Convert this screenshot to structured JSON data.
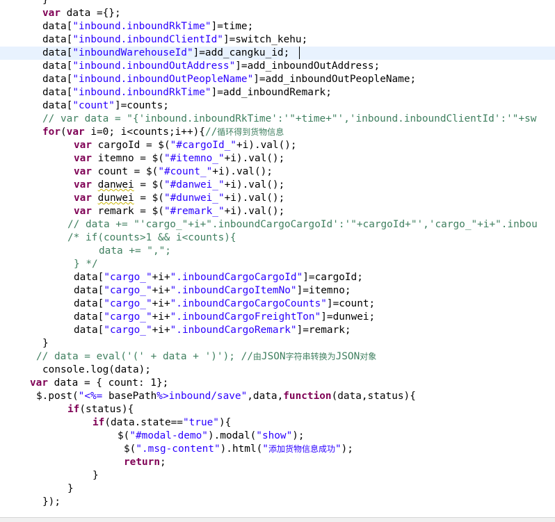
{
  "editor": {
    "current_line": 4,
    "lines": [
      {
        "indent": 61,
        "tokens": [
          {
            "t": "}",
            "c": "tx"
          }
        ]
      },
      {
        "indent": 61,
        "tokens": [
          {
            "t": "var",
            "c": "kw"
          },
          {
            "t": " data ={};",
            "c": "tx"
          }
        ]
      },
      {
        "indent": 61,
        "tokens": [
          {
            "t": "data[",
            "c": "tx"
          },
          {
            "t": "\"inbound.inboundRkTime\"",
            "c": "str"
          },
          {
            "t": "]=time;",
            "c": "tx"
          }
        ]
      },
      {
        "indent": 61,
        "tokens": [
          {
            "t": "data[",
            "c": "tx"
          },
          {
            "t": "\"inbound.inboundClientId\"",
            "c": "str"
          },
          {
            "t": "]=switch_kehu;",
            "c": "tx"
          }
        ]
      },
      {
        "indent": 61,
        "tokens": [
          {
            "t": "data[",
            "c": "tx"
          },
          {
            "t": "\"inboundWarehouseId\"",
            "c": "str"
          },
          {
            "t": "]=add_cangku_id;",
            "c": "tx"
          }
        ]
      },
      {
        "indent": 61,
        "tokens": [
          {
            "t": "data[",
            "c": "tx"
          },
          {
            "t": "\"inbound.inboundOutAddress\"",
            "c": "str"
          },
          {
            "t": "]=add_inboundOutAddress;",
            "c": "tx"
          }
        ]
      },
      {
        "indent": 61,
        "tokens": [
          {
            "t": "data[",
            "c": "tx"
          },
          {
            "t": "\"inbound.inboundOutPeopleName\"",
            "c": "str"
          },
          {
            "t": "]=add_inboundOutPeopleName;",
            "c": "tx"
          }
        ]
      },
      {
        "indent": 61,
        "tokens": [
          {
            "t": "data[",
            "c": "tx"
          },
          {
            "t": "\"inbound.inboundRkTime\"",
            "c": "str"
          },
          {
            "t": "]=add_inboundRemark;",
            "c": "tx"
          }
        ]
      },
      {
        "indent": 61,
        "tokens": [
          {
            "t": "data[",
            "c": "tx"
          },
          {
            "t": "\"count\"",
            "c": "str"
          },
          {
            "t": "]=counts;",
            "c": "tx"
          }
        ]
      },
      {
        "indent": 61,
        "tokens": [
          {
            "t": "// var data = \"{'inbound.inboundRkTime':'\"+time+\"','inbound.inboundClientId':'\"+sw",
            "c": "cm"
          }
        ]
      },
      {
        "indent": 61,
        "tokens": [
          {
            "t": "for",
            "c": "kw"
          },
          {
            "t": "(",
            "c": "tx"
          },
          {
            "t": "var",
            "c": "kw"
          },
          {
            "t": " i=0; i<counts;i++){",
            "c": "tx"
          },
          {
            "t": "//",
            "c": "cm"
          },
          {
            "t": "循环得到货物信息",
            "c": "cm",
            "cjk": true
          }
        ]
      },
      {
        "indent": 106,
        "tokens": [
          {
            "t": "var",
            "c": "kw"
          },
          {
            "t": " cargoId = $(",
            "c": "tx"
          },
          {
            "t": "\"#cargoId_\"",
            "c": "str"
          },
          {
            "t": "+i).val();",
            "c": "tx"
          }
        ]
      },
      {
        "indent": 106,
        "tokens": [
          {
            "t": "var",
            "c": "kw"
          },
          {
            "t": " itemno = $(",
            "c": "tx"
          },
          {
            "t": "\"#itemno_\"",
            "c": "str"
          },
          {
            "t": "+i).val();",
            "c": "tx"
          }
        ]
      },
      {
        "indent": 106,
        "tokens": [
          {
            "t": "var",
            "c": "kw"
          },
          {
            "t": " count = $(",
            "c": "tx"
          },
          {
            "t": "\"#count_\"",
            "c": "str"
          },
          {
            "t": "+i).val();",
            "c": "tx"
          }
        ]
      },
      {
        "indent": 106,
        "tokens": [
          {
            "t": "var",
            "c": "kw"
          },
          {
            "t": " ",
            "c": "tx"
          },
          {
            "t": "danwei",
            "c": "tx",
            "sq": true
          },
          {
            "t": " = $(",
            "c": "tx"
          },
          {
            "t": "\"#danwei_\"",
            "c": "str"
          },
          {
            "t": "+i).val();",
            "c": "tx"
          }
        ]
      },
      {
        "indent": 106,
        "tokens": [
          {
            "t": "var",
            "c": "kw"
          },
          {
            "t": " ",
            "c": "tx"
          },
          {
            "t": "dunwei",
            "c": "tx",
            "sq": true
          },
          {
            "t": " = $(",
            "c": "tx"
          },
          {
            "t": "\"#dunwei_\"",
            "c": "str"
          },
          {
            "t": "+i).val();",
            "c": "tx"
          }
        ]
      },
      {
        "indent": 106,
        "tokens": [
          {
            "t": "var",
            "c": "kw"
          },
          {
            "t": " remark = $(",
            "c": "tx"
          },
          {
            "t": "\"#remark_\"",
            "c": "str"
          },
          {
            "t": "+i).val();",
            "c": "tx"
          }
        ]
      },
      {
        "indent": 97,
        "tokens": [
          {
            "t": "// data += \"'cargo_\"+i+\".inboundCargoCargoId':'\"+cargoId+\"','cargo_\"+i+\".inbou",
            "c": "cm"
          }
        ]
      },
      {
        "indent": 97,
        "tokens": [
          {
            "t": "/* if(counts>1 && i<counts){",
            "c": "cm"
          }
        ]
      },
      {
        "indent": 142,
        "tokens": [
          {
            "t": "data += \",\";",
            "c": "cm"
          }
        ]
      },
      {
        "indent": 106,
        "tokens": [
          {
            "t": "} */",
            "c": "cm"
          }
        ]
      },
      {
        "indent": 106,
        "tokens": [
          {
            "t": "data[",
            "c": "tx"
          },
          {
            "t": "\"cargo_\"",
            "c": "str"
          },
          {
            "t": "+i+",
            "c": "tx"
          },
          {
            "t": "\".inboundCargoCargoId\"",
            "c": "str"
          },
          {
            "t": "]=cargoId;",
            "c": "tx"
          }
        ]
      },
      {
        "indent": 106,
        "tokens": [
          {
            "t": "data[",
            "c": "tx"
          },
          {
            "t": "\"cargo_\"",
            "c": "str"
          },
          {
            "t": "+i+",
            "c": "tx"
          },
          {
            "t": "\".inboundCargoItemNo\"",
            "c": "str"
          },
          {
            "t": "]=itemno;",
            "c": "tx"
          }
        ]
      },
      {
        "indent": 106,
        "tokens": [
          {
            "t": "data[",
            "c": "tx"
          },
          {
            "t": "\"cargo_\"",
            "c": "str"
          },
          {
            "t": "+i+",
            "c": "tx"
          },
          {
            "t": "\".inboundCargoCargoCounts\"",
            "c": "str"
          },
          {
            "t": "]=count;",
            "c": "tx"
          }
        ]
      },
      {
        "indent": 106,
        "tokens": [
          {
            "t": "data[",
            "c": "tx"
          },
          {
            "t": "\"cargo_\"",
            "c": "str"
          },
          {
            "t": "+i+",
            "c": "tx"
          },
          {
            "t": "\".inboundCargoFreightTon\"",
            "c": "str"
          },
          {
            "t": "]=dunwei;",
            "c": "tx"
          }
        ]
      },
      {
        "indent": 106,
        "tokens": [
          {
            "t": "data[",
            "c": "tx"
          },
          {
            "t": "\"cargo_\"",
            "c": "str"
          },
          {
            "t": "+i+",
            "c": "tx"
          },
          {
            "t": "\".inboundCargoRemark\"",
            "c": "str"
          },
          {
            "t": "]=remark;",
            "c": "tx"
          }
        ]
      },
      {
        "indent": 61,
        "tokens": [
          {
            "t": "}",
            "c": "tx"
          }
        ]
      },
      {
        "indent": 52,
        "tokens": [
          {
            "t": "// data = eval('(' + data + ')'); //",
            "c": "cm"
          },
          {
            "t": "由",
            "c": "cm",
            "cjk": true
          },
          {
            "t": "JSON",
            "c": "cm"
          },
          {
            "t": "字符串转换为",
            "c": "cm",
            "cjk": true
          },
          {
            "t": "JSON",
            "c": "cm"
          },
          {
            "t": "对象",
            "c": "cm",
            "cjk": true
          }
        ]
      },
      {
        "indent": 61,
        "tokens": [
          {
            "t": "console.log(data);",
            "c": "tx"
          }
        ]
      },
      {
        "indent": 43,
        "tokens": [
          {
            "t": "var",
            "c": "kw"
          },
          {
            "t": " data = { count: 1};",
            "c": "tx"
          }
        ]
      },
      {
        "indent": 52,
        "tokens": [
          {
            "t": "$.post(",
            "c": "tx"
          },
          {
            "t": "\"<%= ",
            "c": "str"
          },
          {
            "t": "basePath",
            "c": "tx"
          },
          {
            "t": "%>inbound/save\"",
            "c": "str"
          },
          {
            "t": ",data,",
            "c": "tx"
          },
          {
            "t": "function",
            "c": "kw"
          },
          {
            "t": "(data,status){",
            "c": "tx"
          }
        ]
      },
      {
        "indent": 97,
        "tokens": [
          {
            "t": "if",
            "c": "kw"
          },
          {
            "t": "(status){",
            "c": "tx"
          }
        ]
      },
      {
        "indent": 133,
        "tokens": [
          {
            "t": "if",
            "c": "kw"
          },
          {
            "t": "(data.state==",
            "c": "tx"
          },
          {
            "t": "\"true\"",
            "c": "str"
          },
          {
            "t": "){",
            "c": "tx"
          }
        ]
      },
      {
        "indent": 169,
        "tokens": [
          {
            "t": "$(",
            "c": "tx"
          },
          {
            "t": "\"#modal-demo\"",
            "c": "str"
          },
          {
            "t": ").modal(",
            "c": "tx"
          },
          {
            "t": "\"show\"",
            "c": "str"
          },
          {
            "t": ");",
            "c": "tx"
          }
        ]
      },
      {
        "indent": 178,
        "tokens": [
          {
            "t": "$(",
            "c": "tx"
          },
          {
            "t": "\".msg-content\"",
            "c": "str"
          },
          {
            "t": ").html(",
            "c": "tx"
          },
          {
            "t": "\"",
            "c": "str"
          },
          {
            "t": "添加货物信息成功",
            "c": "str",
            "cjk": true
          },
          {
            "t": "\"",
            "c": "str"
          },
          {
            "t": ");",
            "c": "tx"
          }
        ]
      },
      {
        "indent": 178,
        "tokens": [
          {
            "t": "return",
            "c": "kw"
          },
          {
            "t": ";",
            "c": "tx"
          }
        ]
      },
      {
        "indent": 133,
        "tokens": [
          {
            "t": "}",
            "c": "tx"
          }
        ]
      },
      {
        "indent": 97,
        "tokens": [
          {
            "t": "}",
            "c": "tx"
          }
        ]
      },
      {
        "indent": 61,
        "tokens": [
          {
            "t": "});",
            "c": "tx"
          }
        ]
      }
    ]
  }
}
